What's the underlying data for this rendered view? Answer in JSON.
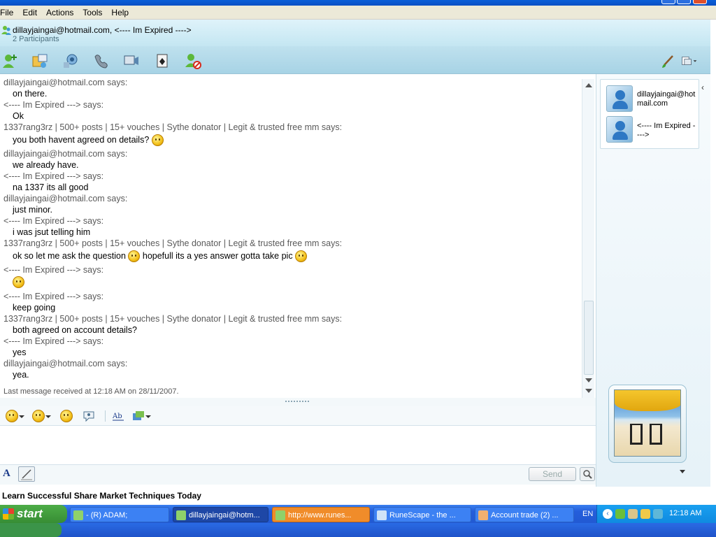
{
  "menu": [
    "File",
    "Edit",
    "Actions",
    "Tools",
    "Help"
  ],
  "conversation": {
    "title": "dillayjaingai@hotmail.com, <---- Im Expired ---->",
    "participants_count": "2 Participants"
  },
  "toolbar_icons": [
    "invite-contact-icon",
    "send-files-icon",
    "webcam-icon",
    "call-icon",
    "video-call-icon",
    "games-icon",
    "block-contact-icon",
    "background-brush-icon",
    "menu-display-icon"
  ],
  "chat": [
    {
      "kind": "says",
      "text": "dillayjaingai@hotmail.com says:"
    },
    {
      "kind": "msg",
      "text": "on there."
    },
    {
      "kind": "says",
      "text": "<---- Im Expired ---> says:"
    },
    {
      "kind": "msg",
      "text": "Ok"
    },
    {
      "kind": "says",
      "text": "1337rang3rz | 500+ posts | 15+ vouches | Sythe donator | Legit & trusted free mm says:"
    },
    {
      "kind": "msg",
      "text": "you both havent agreed on details?"
    },
    {
      "kind": "says",
      "text": "dillayjaingai@hotmail.com says:"
    },
    {
      "kind": "msg",
      "text": "we already have."
    },
    {
      "kind": "says",
      "text": "<---- Im Expired ---> says:"
    },
    {
      "kind": "msg",
      "text": "na 1337 its all good"
    },
    {
      "kind": "says",
      "text": "dillayjaingai@hotmail.com says:"
    },
    {
      "kind": "msg",
      "text": "just minor."
    },
    {
      "kind": "says",
      "text": "<---- Im Expired ---> says:"
    },
    {
      "kind": "msg",
      "text": "i was jsut telling him"
    },
    {
      "kind": "says",
      "text": "1337rang3rz | 500+ posts | 15+ vouches | Sythe donator | Legit & trusted free mm says:"
    },
    {
      "kind": "msg",
      "text": "ok so let me ask the question",
      "text2": "hopefull its a yes answer gotta take pic"
    },
    {
      "kind": "says",
      "text": "<---- Im Expired ---> says:"
    },
    {
      "kind": "emote",
      "text": ""
    },
    {
      "kind": "says",
      "text": "<---- Im Expired ---> says:"
    },
    {
      "kind": "msg",
      "text": "keep going"
    },
    {
      "kind": "says",
      "text": "1337rang3rz | 500+ posts | 15+ vouches | Sythe donator | Legit & trusted free mm says:"
    },
    {
      "kind": "msg",
      "text": "both agreed on account details?"
    },
    {
      "kind": "says",
      "text": "<---- Im Expired ---> says:"
    },
    {
      "kind": "msg",
      "text": "yes"
    },
    {
      "kind": "says",
      "text": "dillayjaingai@hotmail.com says:"
    },
    {
      "kind": "msg",
      "text": "yea."
    }
  ],
  "status_line": "Last message received at 12:18 AM on 28/11/2007.",
  "participants": [
    {
      "name": "dillayjaingai@hotmail.com"
    },
    {
      "name": "<---- Im Expired ---->"
    }
  ],
  "send_label": "Send",
  "font_label": "A",
  "ad_text": "Learn Successful Share Market Techniques Today",
  "taskbar": {
    "start_label": "start",
    "tasks": [
      {
        "label": "- (R) ADAM;"
      },
      {
        "label": "dillayjaingai@hotm..."
      },
      {
        "label": "http://www.runes..."
      },
      {
        "label": "RuneScape - the ..."
      },
      {
        "label": "Account trade (2) ..."
      }
    ],
    "language": "EN",
    "clock": "12:18 AM"
  },
  "colors": {
    "header_bg": "#c4e6f2",
    "says_text": "#5a5a5a",
    "taskbar_blue": "#245edb",
    "start_green": "#378d34",
    "flash_task": "#f08c2a"
  }
}
